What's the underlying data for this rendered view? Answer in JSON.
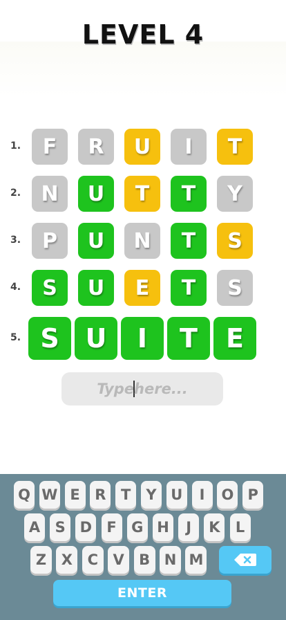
{
  "title": "LEVEL 4",
  "colors": {
    "gray": "#c8c8c8",
    "green": "#1ec31e",
    "yellow": "#f6c00e",
    "key_blue": "#55c8f5",
    "keyboard_bg": "#6b8a96"
  },
  "guesses": [
    {
      "number": "1.",
      "letters": [
        "F",
        "R",
        "U",
        "I",
        "T"
      ],
      "states": [
        "gray",
        "gray",
        "yellow",
        "gray",
        "yellow"
      ]
    },
    {
      "number": "2.",
      "letters": [
        "N",
        "U",
        "T",
        "T",
        "Y"
      ],
      "states": [
        "gray",
        "green",
        "yellow",
        "green",
        "gray"
      ]
    },
    {
      "number": "3.",
      "letters": [
        "P",
        "U",
        "N",
        "T",
        "S"
      ],
      "states": [
        "gray",
        "green",
        "gray",
        "green",
        "yellow"
      ]
    },
    {
      "number": "4.",
      "letters": [
        "S",
        "U",
        "E",
        "T",
        "S"
      ],
      "states": [
        "green",
        "green",
        "yellow",
        "green",
        "gray"
      ]
    },
    {
      "number": "5.",
      "letters": [
        "S",
        "U",
        "I",
        "T",
        "E"
      ],
      "states": [
        "green",
        "green",
        "green",
        "green",
        "green"
      ]
    }
  ],
  "input": {
    "placeholder_a": "Type",
    "placeholder_b": "here..."
  },
  "keyboard": {
    "row1": [
      "Q",
      "W",
      "E",
      "R",
      "T",
      "Y",
      "U",
      "I",
      "O",
      "P"
    ],
    "row2": [
      "A",
      "S",
      "D",
      "F",
      "G",
      "H",
      "J",
      "K",
      "L"
    ],
    "row3": [
      "Z",
      "X",
      "C",
      "V",
      "B",
      "N",
      "M"
    ],
    "backspace_icon": "backspace-icon",
    "enter_label": "ENTER"
  }
}
